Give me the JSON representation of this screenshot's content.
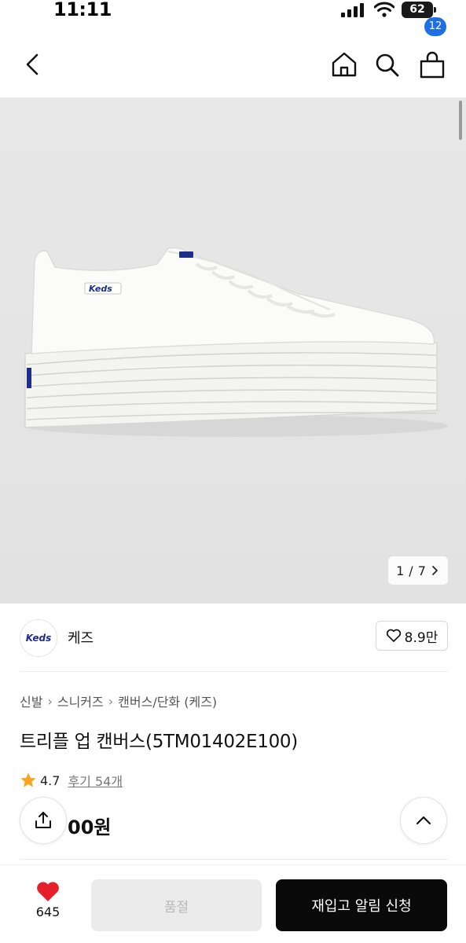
{
  "status_bar": {
    "time": "11:11",
    "battery": "62"
  },
  "header": {
    "cart_count": "12",
    "icons": [
      "back-icon",
      "home-icon",
      "search-icon",
      "cart-icon"
    ]
  },
  "gallery": {
    "current": "1",
    "separator": "/",
    "total": "7",
    "shoe_label": "Keds"
  },
  "brand": {
    "logo_text": "Keds",
    "name": "케즈",
    "likes": "8.9만"
  },
  "breadcrumb": [
    "신발",
    "스니커즈",
    "캔버스/단화 (케즈)"
  ],
  "product": {
    "title": "트리플 업 캔버스(5TM01402E100)",
    "rating": "4.7",
    "reviews": "후기 54개",
    "price": "00원"
  },
  "bottom_bar": {
    "wish_count": "645",
    "soldout_label": "품절",
    "restock_label": "재입고 알림 신청"
  },
  "colors": {
    "accent_badge": "#1f6fe5",
    "heart": "#e5202b",
    "star": "#f5a623",
    "primary_button": "#0a0a0a"
  }
}
